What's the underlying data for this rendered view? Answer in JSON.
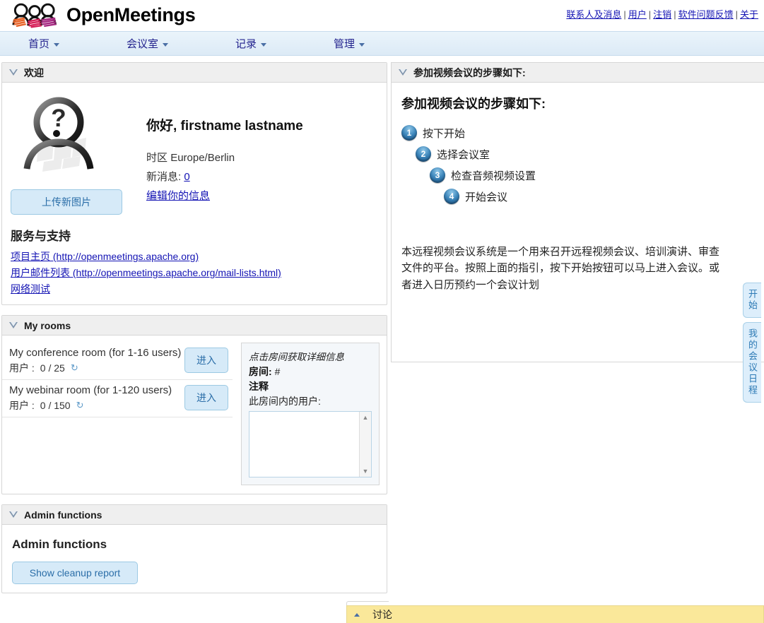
{
  "header": {
    "brand": "OpenMeetings",
    "logo_icon": "three-people-logo",
    "links": [
      {
        "label": "联系人及消息",
        "name": "contacts-and-messages"
      },
      {
        "label": "用户",
        "name": "users"
      },
      {
        "label": "注销",
        "name": "logout"
      },
      {
        "label": "软件问题反馈",
        "name": "report-bug"
      },
      {
        "label": "关于",
        "name": "about"
      }
    ],
    "separator": "|"
  },
  "nav": {
    "items": [
      {
        "label": "首页",
        "name": "home"
      },
      {
        "label": "会议室",
        "name": "rooms"
      },
      {
        "label": "记录",
        "name": "recordings"
      },
      {
        "label": "管理",
        "name": "administration"
      }
    ],
    "caret_icon": "chevron-down-icon"
  },
  "welcome": {
    "panel_title": "欢迎",
    "collapse_icon": "triangle-down-icon",
    "avatar_icon": "unknown-user-avatar",
    "upload_button": "上传新图片",
    "greeting": "你好, firstname lastname",
    "timezone_label": "时区",
    "timezone_value": "Europe/Berlin",
    "new_messages_label": "新消息:",
    "new_messages_count": "0",
    "edit_profile_link": "编辑你的信息",
    "support_title": "服务与支持",
    "support_links": [
      {
        "label": "项目主页 (http://openmeetings.apache.org)",
        "name": "project-homepage"
      },
      {
        "label": "用户邮件列表 (http://openmeetings.apache.org/mail-lists.html)",
        "name": "user-mailing-list"
      },
      {
        "label": "网络测试",
        "name": "network-test"
      }
    ]
  },
  "my_rooms": {
    "panel_title": "My rooms",
    "collapse_icon": "triangle-down-icon",
    "enter_button": "进入",
    "refresh_icon": "refresh-icon",
    "rooms": [
      {
        "title": "My conference room (for 1-16 users)",
        "users_label": "用户 :",
        "users_value": "0 / 25"
      },
      {
        "title": "My webinar room (for 1-120 users)",
        "users_label": "用户 :",
        "users_value": "0 / 150"
      }
    ],
    "details": {
      "hint": "点击房间获取详细信息",
      "room_label": "房间:",
      "room_value": "#",
      "comment_label": "注释",
      "users_in_room_label": "此房间内的用户:",
      "users_list": "",
      "scroll_up_icon": "scroll-up-arrow",
      "scroll_down_icon": "scroll-down-arrow"
    }
  },
  "admin": {
    "panel_title": "Admin functions",
    "collapse_icon": "triangle-down-icon",
    "heading": "Admin functions",
    "cleanup_button": "Show cleanup report"
  },
  "steps": {
    "panel_title": "参加视频会议的步骤如下:",
    "collapse_icon": "triangle-down-icon",
    "heading": "参加视频会议的步骤如下:",
    "items": [
      {
        "num": "1",
        "label": "按下开始"
      },
      {
        "num": "2",
        "label": "选择会议室"
      },
      {
        "num": "3",
        "label": "检查音频视频设置"
      },
      {
        "num": "4",
        "label": "开始会议"
      }
    ],
    "paragraph": "本远程视频会议系统是一个用来召开远程视频会议、培训演讲、审查文件的平台。按照上面的指引，按下开始按钮可以马上进入会议。或者进入日历预约一个会议计划"
  },
  "side_tabs": [
    {
      "label": "开始",
      "name": "start"
    },
    {
      "label": "我的会议日程",
      "name": "my-schedule"
    }
  ],
  "chat_bar": {
    "label": "讨论",
    "expand_icon": "chevron-up-icon"
  },
  "colors": {
    "link": "#1414b4",
    "nav_text": "#23238e",
    "button_bg": "#d6eaf8",
    "button_border": "#9cc9e3",
    "button_text": "#2b6ea8",
    "panel_header_bg": "#efefef",
    "chat_bar_bg": "#fae89a"
  }
}
